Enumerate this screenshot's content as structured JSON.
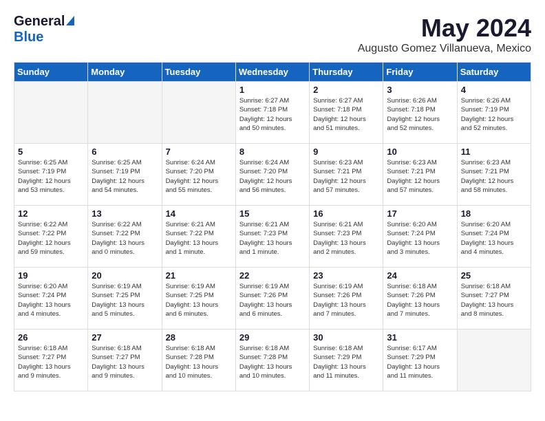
{
  "logo": {
    "general": "General",
    "blue": "Blue"
  },
  "title": {
    "month": "May 2024",
    "location": "Augusto Gomez Villanueva, Mexico"
  },
  "headers": [
    "Sunday",
    "Monday",
    "Tuesday",
    "Wednesday",
    "Thursday",
    "Friday",
    "Saturday"
  ],
  "weeks": [
    [
      {
        "day": "",
        "info": ""
      },
      {
        "day": "",
        "info": ""
      },
      {
        "day": "",
        "info": ""
      },
      {
        "day": "1",
        "info": "Sunrise: 6:27 AM\nSunset: 7:18 PM\nDaylight: 12 hours\nand 50 minutes."
      },
      {
        "day": "2",
        "info": "Sunrise: 6:27 AM\nSunset: 7:18 PM\nDaylight: 12 hours\nand 51 minutes."
      },
      {
        "day": "3",
        "info": "Sunrise: 6:26 AM\nSunset: 7:18 PM\nDaylight: 12 hours\nand 52 minutes."
      },
      {
        "day": "4",
        "info": "Sunrise: 6:26 AM\nSunset: 7:19 PM\nDaylight: 12 hours\nand 52 minutes."
      }
    ],
    [
      {
        "day": "5",
        "info": "Sunrise: 6:25 AM\nSunset: 7:19 PM\nDaylight: 12 hours\nand 53 minutes."
      },
      {
        "day": "6",
        "info": "Sunrise: 6:25 AM\nSunset: 7:19 PM\nDaylight: 12 hours\nand 54 minutes."
      },
      {
        "day": "7",
        "info": "Sunrise: 6:24 AM\nSunset: 7:20 PM\nDaylight: 12 hours\nand 55 minutes."
      },
      {
        "day": "8",
        "info": "Sunrise: 6:24 AM\nSunset: 7:20 PM\nDaylight: 12 hours\nand 56 minutes."
      },
      {
        "day": "9",
        "info": "Sunrise: 6:23 AM\nSunset: 7:21 PM\nDaylight: 12 hours\nand 57 minutes."
      },
      {
        "day": "10",
        "info": "Sunrise: 6:23 AM\nSunset: 7:21 PM\nDaylight: 12 hours\nand 57 minutes."
      },
      {
        "day": "11",
        "info": "Sunrise: 6:23 AM\nSunset: 7:21 PM\nDaylight: 12 hours\nand 58 minutes."
      }
    ],
    [
      {
        "day": "12",
        "info": "Sunrise: 6:22 AM\nSunset: 7:22 PM\nDaylight: 12 hours\nand 59 minutes."
      },
      {
        "day": "13",
        "info": "Sunrise: 6:22 AM\nSunset: 7:22 PM\nDaylight: 13 hours\nand 0 minutes."
      },
      {
        "day": "14",
        "info": "Sunrise: 6:21 AM\nSunset: 7:22 PM\nDaylight: 13 hours\nand 1 minute."
      },
      {
        "day": "15",
        "info": "Sunrise: 6:21 AM\nSunset: 7:23 PM\nDaylight: 13 hours\nand 1 minute."
      },
      {
        "day": "16",
        "info": "Sunrise: 6:21 AM\nSunset: 7:23 PM\nDaylight: 13 hours\nand 2 minutes."
      },
      {
        "day": "17",
        "info": "Sunrise: 6:20 AM\nSunset: 7:24 PM\nDaylight: 13 hours\nand 3 minutes."
      },
      {
        "day": "18",
        "info": "Sunrise: 6:20 AM\nSunset: 7:24 PM\nDaylight: 13 hours\nand 4 minutes."
      }
    ],
    [
      {
        "day": "19",
        "info": "Sunrise: 6:20 AM\nSunset: 7:24 PM\nDaylight: 13 hours\nand 4 minutes."
      },
      {
        "day": "20",
        "info": "Sunrise: 6:19 AM\nSunset: 7:25 PM\nDaylight: 13 hours\nand 5 minutes."
      },
      {
        "day": "21",
        "info": "Sunrise: 6:19 AM\nSunset: 7:25 PM\nDaylight: 13 hours\nand 6 minutes."
      },
      {
        "day": "22",
        "info": "Sunrise: 6:19 AM\nSunset: 7:26 PM\nDaylight: 13 hours\nand 6 minutes."
      },
      {
        "day": "23",
        "info": "Sunrise: 6:19 AM\nSunset: 7:26 PM\nDaylight: 13 hours\nand 7 minutes."
      },
      {
        "day": "24",
        "info": "Sunrise: 6:18 AM\nSunset: 7:26 PM\nDaylight: 13 hours\nand 7 minutes."
      },
      {
        "day": "25",
        "info": "Sunrise: 6:18 AM\nSunset: 7:27 PM\nDaylight: 13 hours\nand 8 minutes."
      }
    ],
    [
      {
        "day": "26",
        "info": "Sunrise: 6:18 AM\nSunset: 7:27 PM\nDaylight: 13 hours\nand 9 minutes."
      },
      {
        "day": "27",
        "info": "Sunrise: 6:18 AM\nSunset: 7:27 PM\nDaylight: 13 hours\nand 9 minutes."
      },
      {
        "day": "28",
        "info": "Sunrise: 6:18 AM\nSunset: 7:28 PM\nDaylight: 13 hours\nand 10 minutes."
      },
      {
        "day": "29",
        "info": "Sunrise: 6:18 AM\nSunset: 7:28 PM\nDaylight: 13 hours\nand 10 minutes."
      },
      {
        "day": "30",
        "info": "Sunrise: 6:18 AM\nSunset: 7:29 PM\nDaylight: 13 hours\nand 11 minutes."
      },
      {
        "day": "31",
        "info": "Sunrise: 6:17 AM\nSunset: 7:29 PM\nDaylight: 13 hours\nand 11 minutes."
      },
      {
        "day": "",
        "info": ""
      }
    ]
  ]
}
